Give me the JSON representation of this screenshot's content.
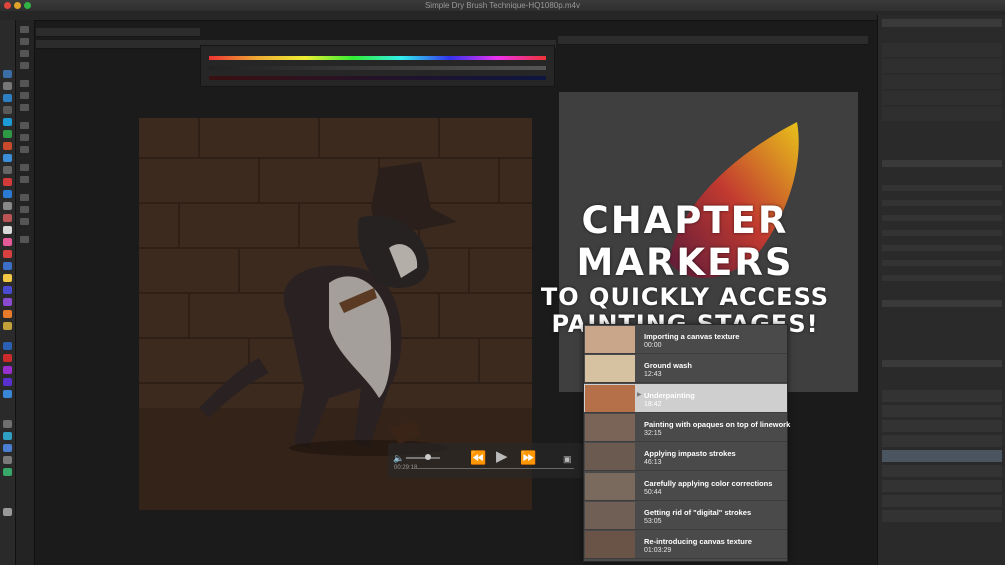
{
  "window": {
    "title": "Simple Dry Brush Technique-HQ1080p.m4v",
    "controls": [
      "close",
      "minimize",
      "zoom"
    ]
  },
  "headline": {
    "line1": "CHAPTER MARKERS",
    "line2": "TO QUICKLY ACCESS",
    "line3": "PAINTING STAGES!"
  },
  "chapters": [
    {
      "title": "Importing a canvas texture",
      "time": "00:00",
      "selected": false
    },
    {
      "title": "Ground wash",
      "time": "12:43",
      "selected": false
    },
    {
      "title": "Underpainting",
      "time": "18:42",
      "selected": true
    },
    {
      "title": "Painting with opaques on top of linework",
      "time": "32:15",
      "selected": false
    },
    {
      "title": "Applying impasto strokes",
      "time": "46:13",
      "selected": false
    },
    {
      "title": "Carefully applying color corrections",
      "time": "50:44",
      "selected": false
    },
    {
      "title": "Getting rid of \"digital\" strokes",
      "time": "53:05",
      "selected": false
    },
    {
      "title": "Re-introducing canvas texture",
      "time": "01:03:29",
      "selected": false
    }
  ],
  "player": {
    "current_time": "00:29:18",
    "volume_fraction": 0.65,
    "icons": [
      "volume-icon",
      "rewind-icon",
      "play-icon",
      "fast-forward-icon",
      "chapters-icon"
    ]
  },
  "colors": {
    "background": "#1b1b1b",
    "selected_row": "#cfcfcf",
    "chapter_panel": "#4a4a4a",
    "canvas_brown": "#3d2a1f"
  }
}
